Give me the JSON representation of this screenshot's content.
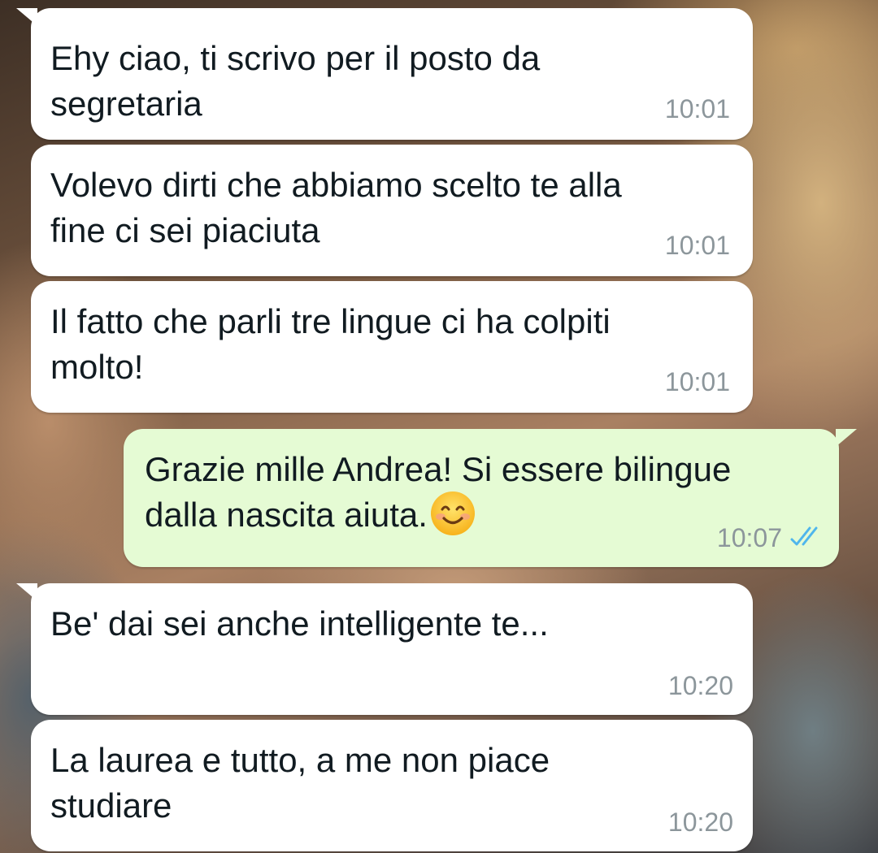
{
  "colors": {
    "incoming_bubble": "#ffffff",
    "outgoing_bubble": "#e5fbd4",
    "message_text": "#111b21",
    "timestamp": "#8c969b",
    "read_ticks": "#4fb6ec"
  },
  "messages": [
    {
      "direction": "incoming",
      "text": "Ehy ciao, ti scrivo per il posto da\nsegretaria",
      "time": "10:01"
    },
    {
      "direction": "incoming",
      "text": "Volevo dirti che abbiamo scelto te alla\nfine ci sei piaciuta",
      "time": "10:01"
    },
    {
      "direction": "incoming",
      "text": "Il fatto che parli tre lingue ci ha colpiti\nmolto!",
      "time": "10:01"
    },
    {
      "direction": "outgoing",
      "text": "Grazie mille Andrea! Si essere bilingue\ndalla nascita aiuta.",
      "emoji": "smiling-face-icon",
      "time": "10:07",
      "status": "read",
      "status_icon": "double-check-icon"
    },
    {
      "direction": "incoming",
      "text": "Be' dai sei anche intelligente te...",
      "time": "10:20"
    },
    {
      "direction": "incoming",
      "text": "La laurea e tutto, a me non piace\nstudiare",
      "time": "10:20"
    }
  ]
}
